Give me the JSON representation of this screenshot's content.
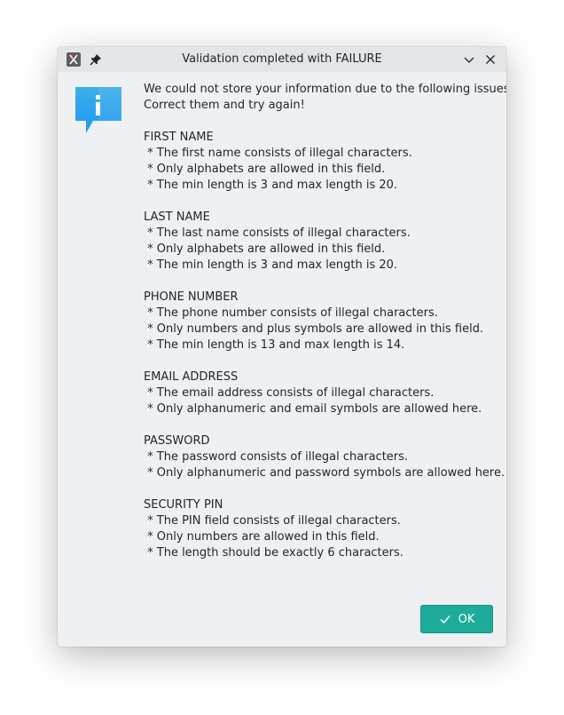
{
  "window": {
    "title": "Validation completed with FAILURE",
    "app_icon": "app-icon",
    "pin_icon": "pin-icon",
    "minimize_icon": "chevron-down-icon",
    "close_icon": "close-icon"
  },
  "message": {
    "icon": "info-icon",
    "intro": [
      "We could not store your information due to the following issues.",
      "Correct them and try again!"
    ],
    "sections": [
      {
        "heading": "FIRST NAME",
        "items": [
          " * The first name consists of illegal characters.",
          " * Only alphabets are allowed in this field.",
          " * The min length is 3 and max length is 20."
        ]
      },
      {
        "heading": "LAST NAME",
        "items": [
          " * The last name consists of illegal characters.",
          " * Only alphabets are allowed in this field.",
          " * The min length is 3 and max length is 20."
        ]
      },
      {
        "heading": "PHONE NUMBER",
        "items": [
          " * The phone number consists of illegal characters.",
          " * Only numbers and plus symbols are allowed in this field.",
          " * The min length is 13 and max length is 14."
        ]
      },
      {
        "heading": "EMAIL ADDRESS",
        "items": [
          " * The email address consists of illegal characters.",
          " * Only alphanumeric and email symbols are allowed here."
        ]
      },
      {
        "heading": "PASSWORD",
        "items": [
          " * The password consists of illegal characters.",
          " * Only alphanumeric and password symbols are allowed here."
        ]
      },
      {
        "heading": "SECURITY PIN",
        "items": [
          " * The PIN field consists of illegal characters.",
          " * Only numbers are allowed in this field.",
          " * The length should be exactly 6 characters."
        ]
      }
    ]
  },
  "buttons": {
    "ok_label": "OK",
    "ok_icon": "checkmark-icon",
    "ok_color": "#1dac9a"
  }
}
